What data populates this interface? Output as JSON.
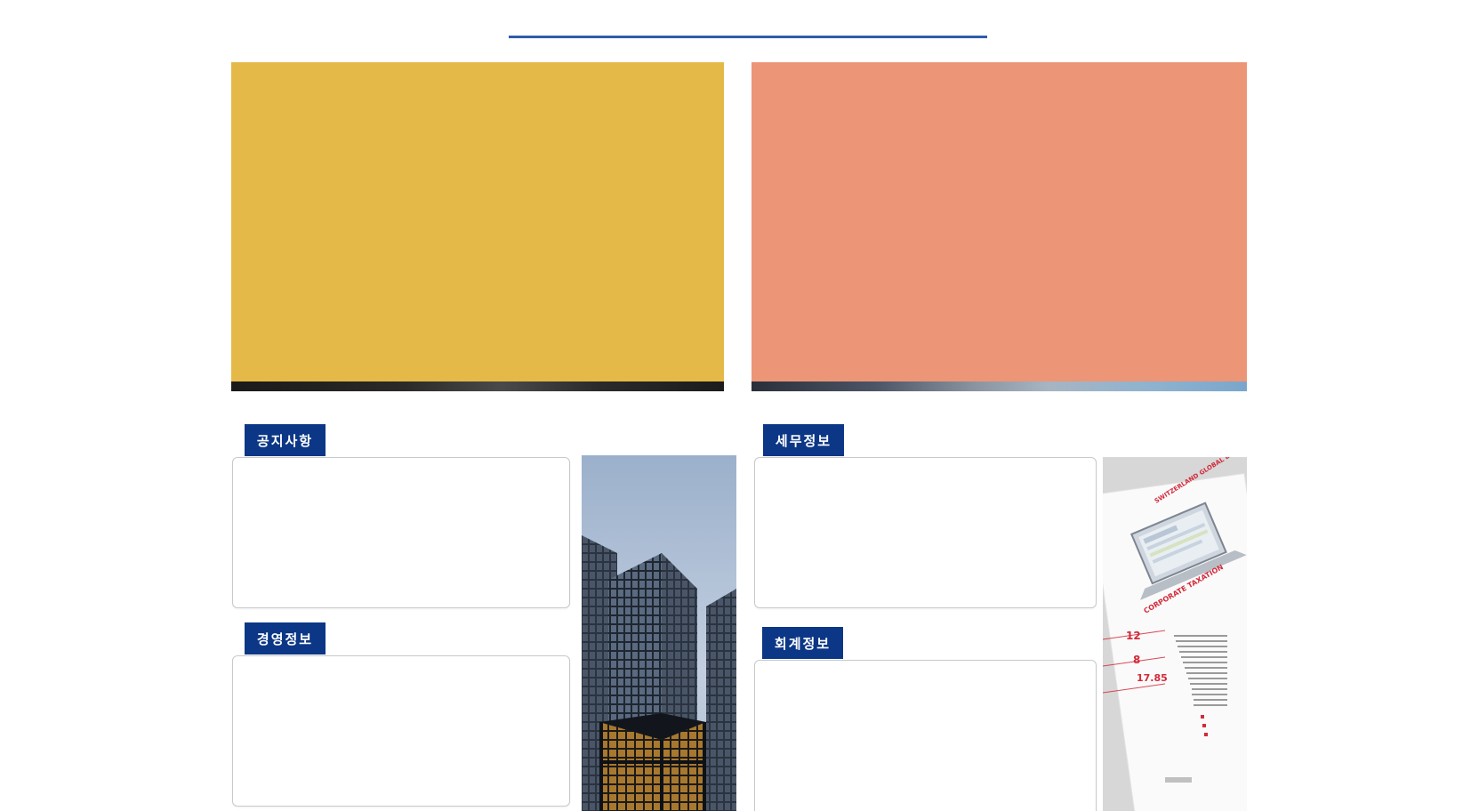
{
  "banners": {
    "left": {
      "color": "#e4b948"
    },
    "right": {
      "color": "#ec9577"
    }
  },
  "sections": {
    "notice": {
      "label": "공지사항"
    },
    "management": {
      "label": "경영정보"
    },
    "tax": {
      "label": "세무정보"
    },
    "accounting": {
      "label": "회계정보"
    }
  },
  "brochure": {
    "brand": "SWITZERLAND GLOBAL ENTERPRISE",
    "title": "CORPORATE TAXATION",
    "numbers": [
      "12",
      "8",
      "17.85"
    ]
  },
  "colors": {
    "accent": "#0c3786",
    "underline": "#2f5ca8"
  }
}
